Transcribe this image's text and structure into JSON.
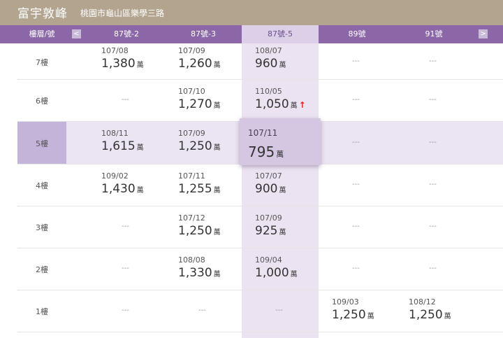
{
  "header": {
    "title": "富宇敦峰",
    "address": "桃園市龜山區樂學三路"
  },
  "columns": {
    "floor_label": "樓層/號",
    "prev_icon": "chevron-left-icon",
    "next_icon": "chevron-right-icon",
    "prev_glyph": "<",
    "next_glyph": ">",
    "units": [
      "87號-2",
      "87號-3",
      "87號-5",
      "89號",
      "91號"
    ],
    "selected_unit": "87號-5"
  },
  "unit_label": "萬",
  "empty": "---",
  "colors": {
    "header": "#b3a48f",
    "column_header": "#8b67a8",
    "selected": "#dcd0e8",
    "up_arrow": "#e02020"
  },
  "rows": [
    {
      "floor": "7樓",
      "cells": [
        {
          "date": "107/08",
          "price": "1,380"
        },
        {
          "date": "107/09",
          "price": "1,260"
        },
        {
          "date": "108/07",
          "price": "960"
        },
        null,
        null
      ]
    },
    {
      "floor": "6樓",
      "cells": [
        null,
        {
          "date": "107/10",
          "price": "1,270"
        },
        {
          "date": "110/05",
          "price": "1,050",
          "trend": "up"
        },
        null,
        null
      ]
    },
    {
      "floor": "5樓",
      "selected": true,
      "cells": [
        {
          "date": "108/11",
          "price": "1,615"
        },
        {
          "date": "107/09",
          "price": "1,250"
        },
        {
          "date": "107/11",
          "price": "795",
          "highlighted": true
        },
        null,
        null
      ]
    },
    {
      "floor": "4樓",
      "cells": [
        {
          "date": "109/02",
          "price": "1,430"
        },
        {
          "date": "107/11",
          "price": "1,255"
        },
        {
          "date": "107/07",
          "price": "900"
        },
        null,
        null
      ]
    },
    {
      "floor": "3樓",
      "cells": [
        null,
        {
          "date": "107/12",
          "price": "1,250"
        },
        {
          "date": "107/09",
          "price": "925"
        },
        null,
        null
      ]
    },
    {
      "floor": "2樓",
      "cells": [
        null,
        {
          "date": "108/08",
          "price": "1,330"
        },
        {
          "date": "109/04",
          "price": "1,000"
        },
        null,
        null
      ]
    },
    {
      "floor": "1樓",
      "cells": [
        null,
        null,
        null,
        {
          "date": "109/03",
          "price": "1,250"
        },
        {
          "date": "108/12",
          "price": "1,250"
        }
      ]
    }
  ]
}
